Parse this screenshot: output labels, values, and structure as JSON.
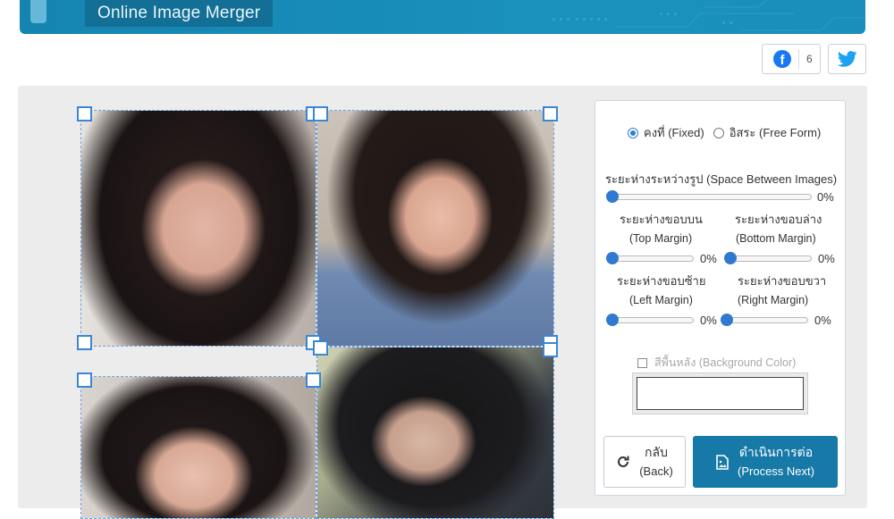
{
  "header": {
    "title": "Online Image Merger",
    "accent_color": "#1a8cb8"
  },
  "share": {
    "facebook_icon": "facebook-icon",
    "facebook_count": "6",
    "twitter_icon": "twitter-icon"
  },
  "layout_mode": {
    "fixed_label": "คงที่ (Fixed)",
    "free_label": "อิสระ (Free Form)",
    "selected": "fixed"
  },
  "spacing": {
    "label": "ระยะห่างระหว่างรูป (Space Between Images)",
    "value": "0%"
  },
  "margins": {
    "top": {
      "label": "ระยะห่างขอบบน",
      "sub": "(Top Margin)",
      "value": "0%"
    },
    "bottom": {
      "label": "ระยะห่างขอบล่าง",
      "sub": "(Bottom Margin)",
      "value": "0%"
    },
    "left": {
      "label": "ระยะห่างขอบซ้าย",
      "sub": "(Left Margin)",
      "value": "0%"
    },
    "right": {
      "label": "ระยะห่างขอบขวา",
      "sub": "(Right Margin)",
      "value": "0%"
    }
  },
  "background": {
    "label": "สีพื้นหลัง (Background Color)",
    "checked": false,
    "color": "#ffffff"
  },
  "buttons": {
    "back_th": "กลับ",
    "back_en": "(Back)",
    "back_icon": "refresh-icon",
    "next_th": "ดำเนินการต่อ",
    "next_en": "(Process Next)",
    "next_icon": "image-file-icon"
  },
  "canvas": {
    "tiles": [
      {
        "name": "image-tile-1",
        "subject": "photo"
      },
      {
        "name": "image-tile-2",
        "subject": "photo"
      },
      {
        "name": "image-tile-3",
        "subject": "photo"
      },
      {
        "name": "image-tile-4",
        "subject": "photo"
      }
    ]
  }
}
